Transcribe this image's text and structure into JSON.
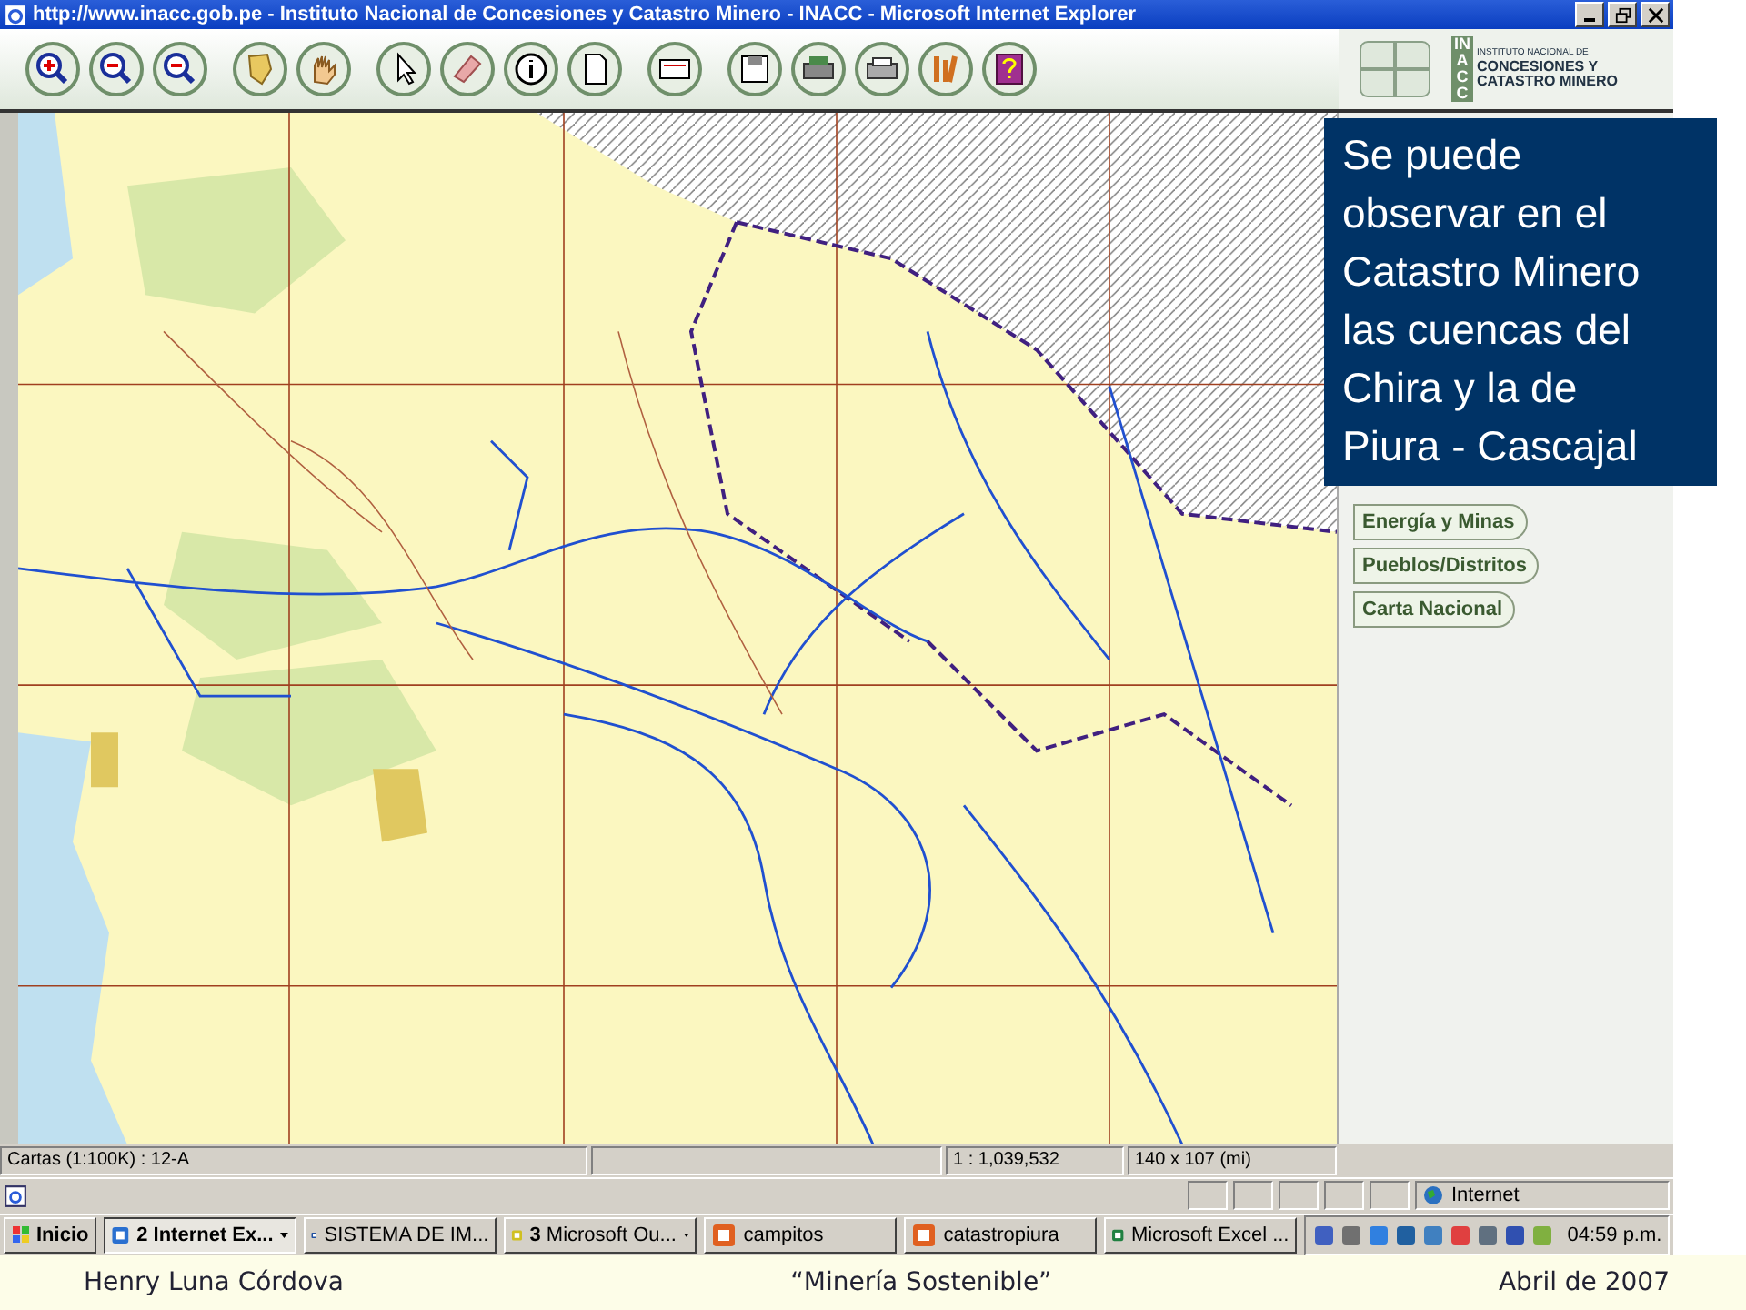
{
  "window": {
    "title": "http://www.inacc.gob.pe - Instituto Nacional de Concesiones y Catastro Minero - INACC - Microsoft Internet Explorer"
  },
  "logo": {
    "abbrev": "INACC",
    "lines": [
      "INSTITUTO NACIONAL DE",
      "CONCESIONES  Y",
      "CATASTRO MINERO"
    ]
  },
  "callout": {
    "text": "Se puede observar en el Catastro Minero las cuencas del Chira y la de Piura - Cascajal"
  },
  "layer_buttons": [
    "Energía y Minas",
    "Pueblos/Distritos",
    "Carta Nacional"
  ],
  "status_bar": {
    "cells": [
      "Cartas (1:100K) : 12-A",
      "1 : 1,039,532",
      "140 x 107 (mi)"
    ]
  },
  "ie_status": {
    "zone": "Internet"
  },
  "taskbar": {
    "start": "Inicio",
    "tasks": [
      {
        "label": "2 Internet Ex...",
        "selected": true,
        "dropdown": true
      },
      {
        "label": "SISTEMA DE IM...",
        "selected": false,
        "dropdown": false
      },
      {
        "label": "**3** Microsoft Ou...",
        "selected": false,
        "dropdown": true
      },
      {
        "label": "campitos",
        "selected": false,
        "dropdown": false
      },
      {
        "label": "catastropiura",
        "selected": false,
        "dropdown": false
      },
      {
        "label": "Microsoft Excel ...",
        "selected": false,
        "dropdown": false
      }
    ],
    "clock": "04:59 p.m."
  },
  "footer": [
    "Henry Luna Córdova",
    "“Minería Sostenible”",
    "Abril de 2007"
  ]
}
